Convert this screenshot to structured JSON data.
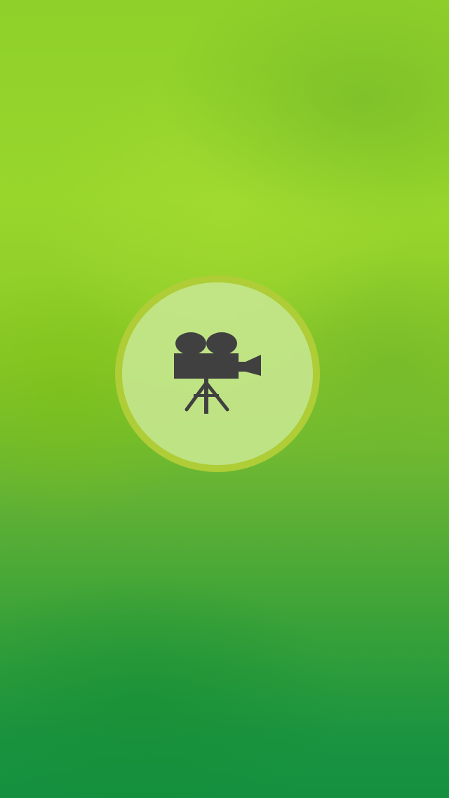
{
  "screen": {
    "background_gradient": [
      "#98d62c",
      "#8cc928",
      "#3aa238",
      "#14903f"
    ]
  },
  "record_button": {
    "icon": "movie-camera-icon",
    "ring_color": "#aecd36",
    "fill_color": "#c4e68c",
    "icon_color": "#404040"
  }
}
